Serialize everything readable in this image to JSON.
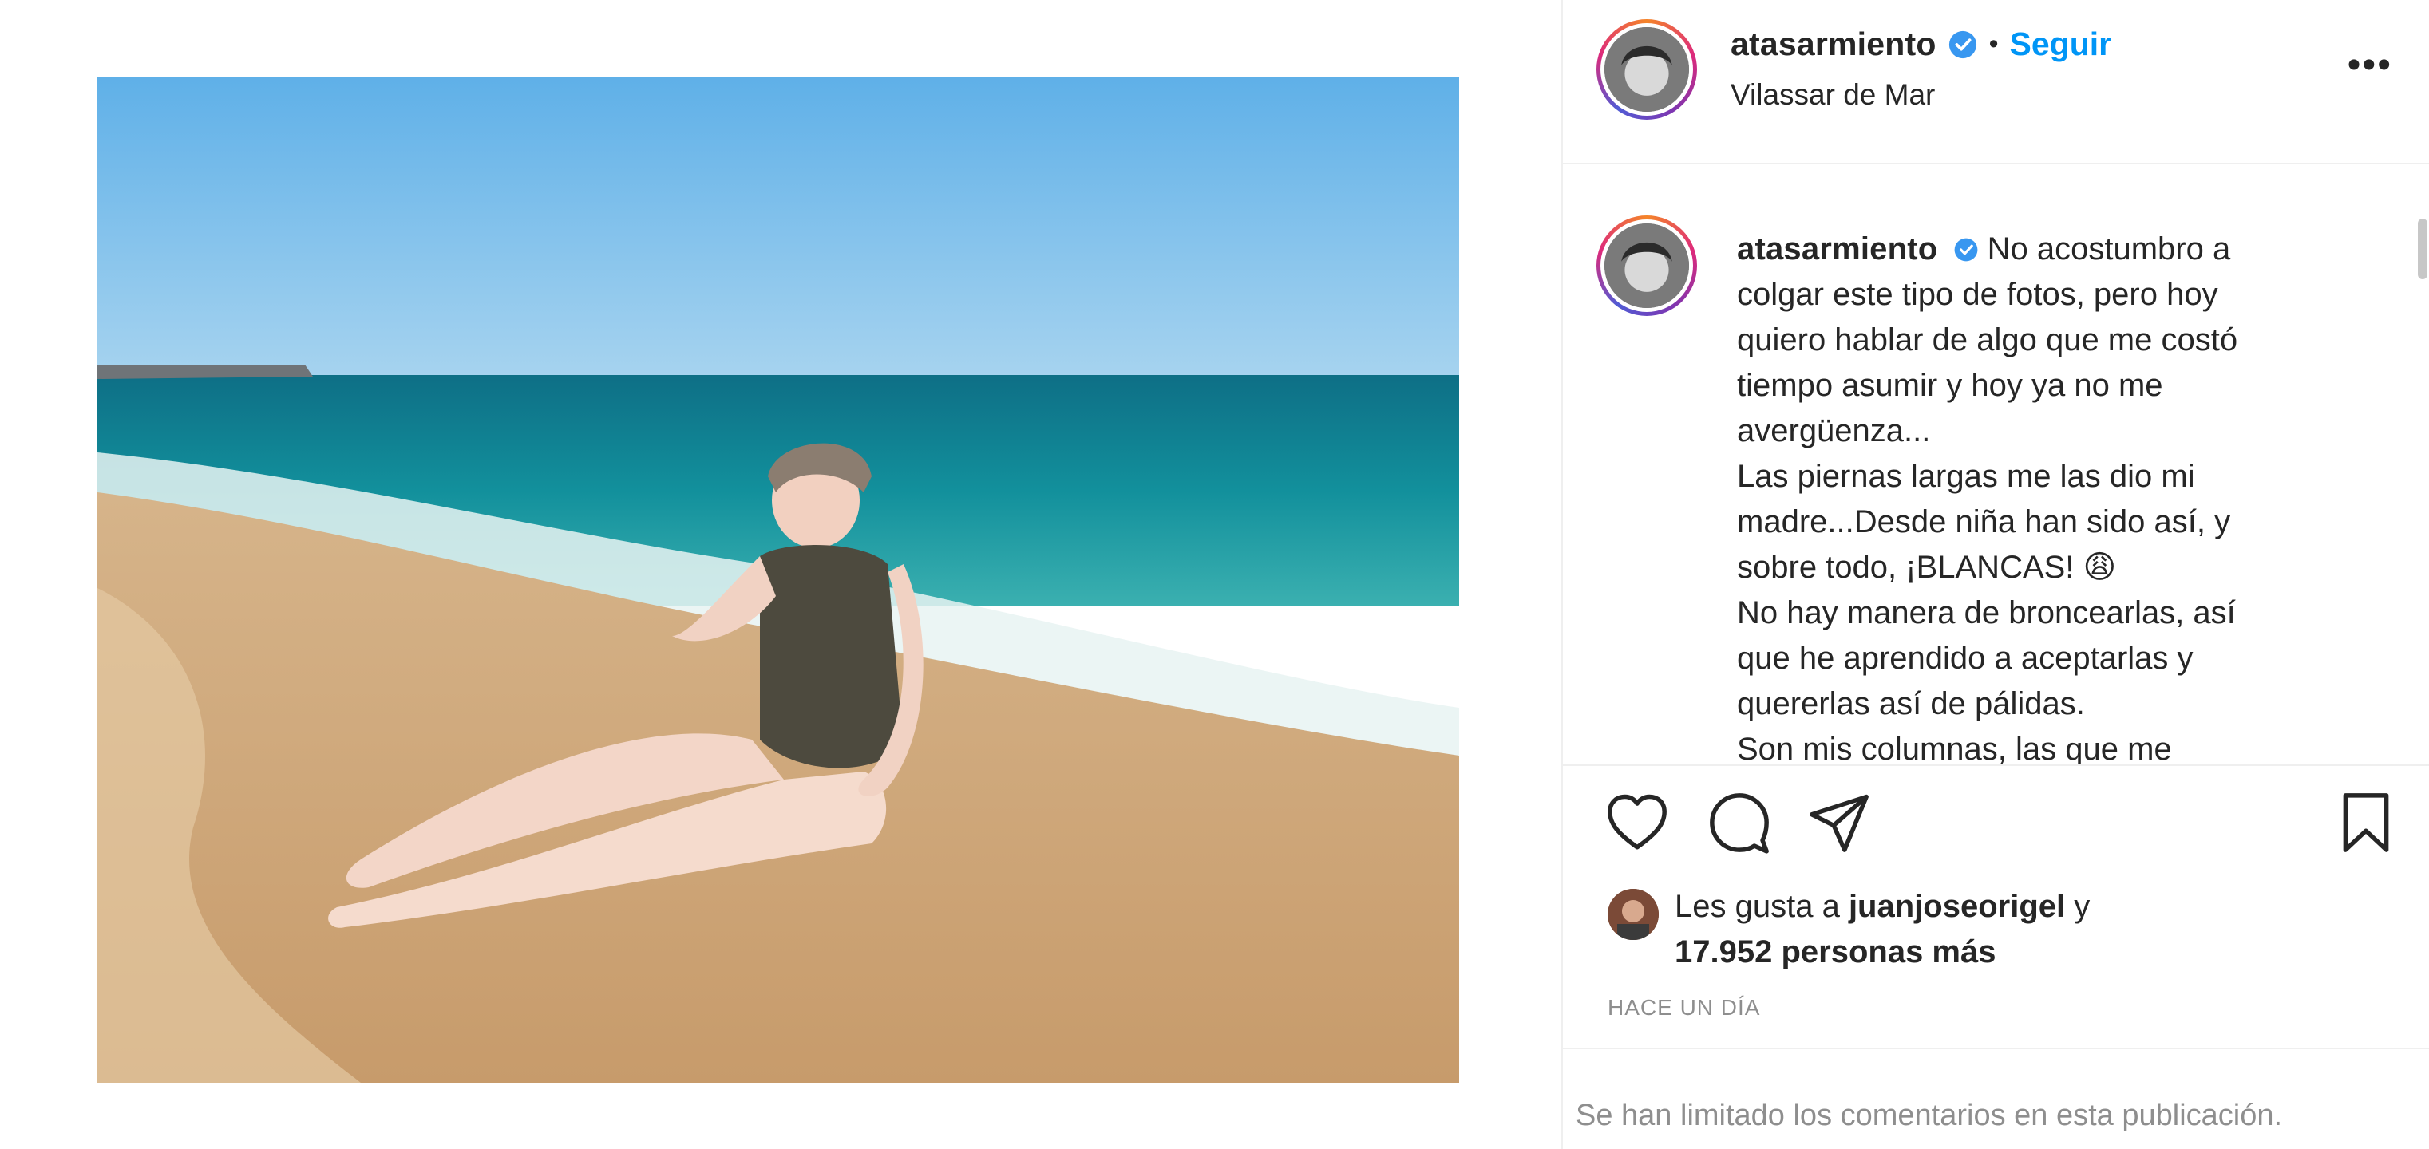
{
  "post": {
    "username": "atasarmiento",
    "separator": "•",
    "follow_label": "Seguir",
    "location": "Vilassar de Mar",
    "more_label": "•••"
  },
  "caption": {
    "username": "atasarmiento",
    "lines": [
      "No acostumbro a",
      "colgar este tipo de fotos, pero hoy",
      "quiero hablar de algo que me costó",
      "tiempo asumir y hoy ya no me",
      "avergüenza...",
      "Las piernas largas me las dio mi",
      "madre...Desde niña han sido así, y",
      "sobre todo, ¡BLANCAS! 😩",
      "No hay manera de broncearlas, así",
      "que he aprendido a aceptarlas y",
      "quererlas así de pálidas.",
      "Son mis columnas, las que me"
    ]
  },
  "likes": {
    "prefix": "Les gusta a ",
    "user": "juanjoseorigel",
    "suffix": " y",
    "count_line": "17.952 personas más"
  },
  "timestamp": "HACE UN DÍA",
  "comments_notice": "Se han limitado los comentarios en esta publicación.",
  "icons": [
    "heart-icon",
    "comment-icon",
    "share-icon",
    "bookmark-icon",
    "verified-icon",
    "more-icon"
  ],
  "colors": {
    "follow": "#0095f6",
    "verified": "#3897f0",
    "muted": "#8e8e8e",
    "text": "#262626"
  }
}
